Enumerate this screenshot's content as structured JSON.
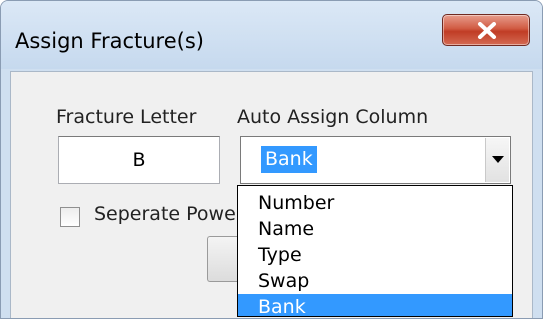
{
  "window": {
    "title": "Assign Fracture(s)"
  },
  "fracture_letter": {
    "label": "Fracture Letter",
    "value": "B"
  },
  "auto_assign": {
    "label": "Auto Assign Column",
    "selected": "Bank",
    "options": [
      "Number",
      "Name",
      "Type",
      "Swap",
      "Bank"
    ]
  },
  "separate": {
    "label": "Seperate Powe",
    "checked": false
  },
  "colors": {
    "selection": "#3399ff",
    "close_button": "#c9452f"
  }
}
